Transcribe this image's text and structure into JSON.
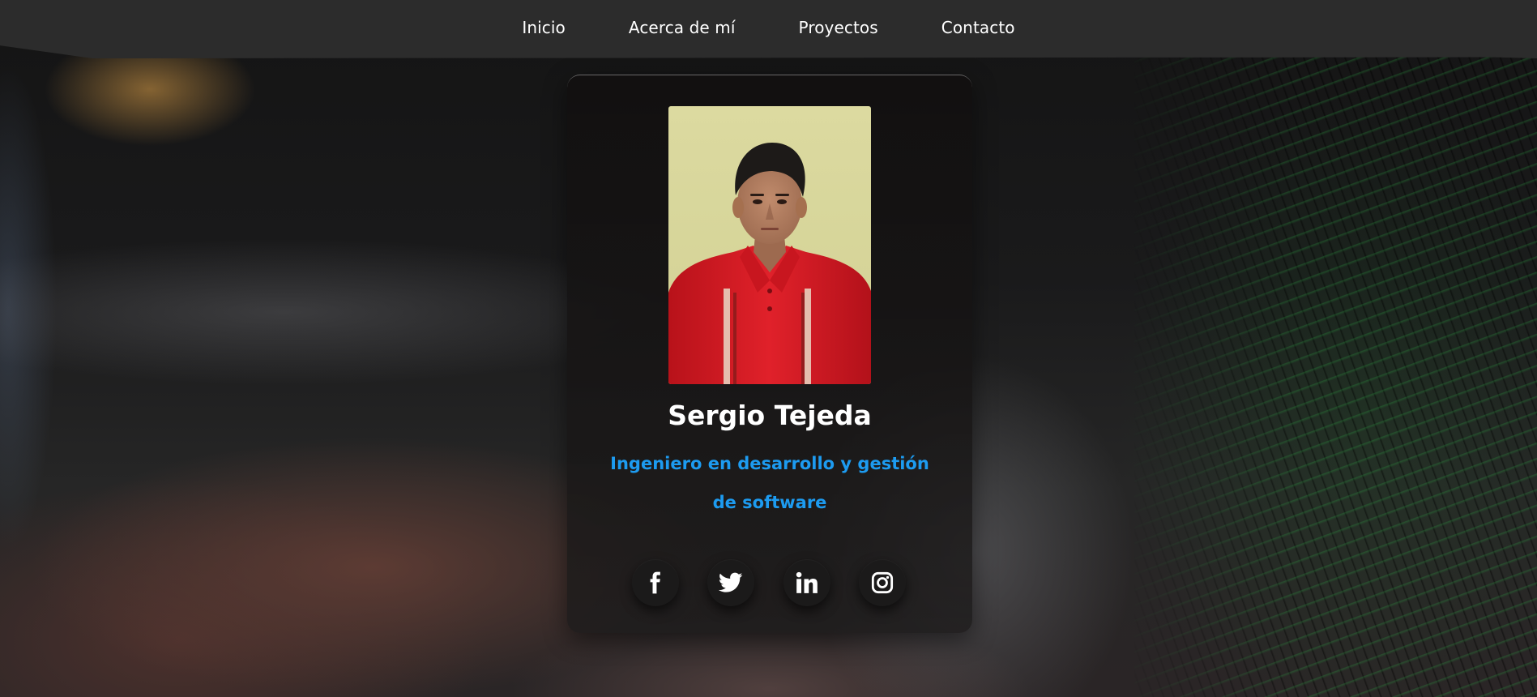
{
  "nav": {
    "items": [
      {
        "label": "Inicio"
      },
      {
        "label": "Acerca de mí"
      },
      {
        "label": "Proyectos"
      },
      {
        "label": "Contacto"
      }
    ]
  },
  "profile": {
    "name": "Sergio Tejeda",
    "role": "Ingeniero en desarrollo y gestión de software",
    "photo_icon": "profile-photo"
  },
  "socials": [
    {
      "icon": "facebook-icon"
    },
    {
      "icon": "twitter-icon"
    },
    {
      "icon": "linkedin-icon"
    },
    {
      "icon": "instagram-icon"
    }
  ],
  "colors": {
    "accent": "#1d9bf0",
    "navbar": "#2c2c2c",
    "card": "#141212",
    "text": "#ffffff"
  }
}
